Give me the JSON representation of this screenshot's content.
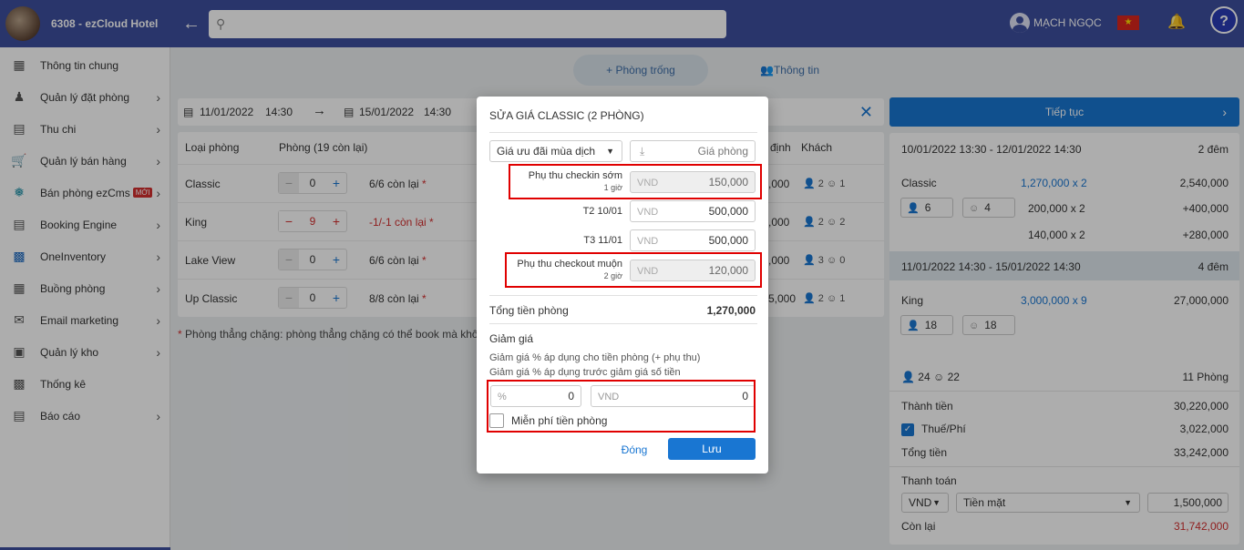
{
  "header": {
    "hotel_name": "6308 - ezCloud Hotel",
    "user_name": "MẠCH NGỌC",
    "help_label": "?"
  },
  "sidebar": {
    "items": [
      {
        "label": "Thông tin chung",
        "icon": "dashboard-icon"
      },
      {
        "label": "Quản lý đặt phòng",
        "icon": "person-bed-icon"
      },
      {
        "label": "Thu chi",
        "icon": "card-icon"
      },
      {
        "label": "Quản lý bán hàng",
        "icon": "cart-icon"
      },
      {
        "label": "Bán phòng ezCms",
        "icon": "cms-icon",
        "badge": "MỚI"
      },
      {
        "label": "Booking Engine",
        "icon": "booking-icon"
      },
      {
        "label": "OneInventory",
        "icon": "inventory-icon"
      },
      {
        "label": "Buồng phòng",
        "icon": "building-icon"
      },
      {
        "label": "Email marketing",
        "icon": "mail-icon"
      },
      {
        "label": "Quản lý kho",
        "icon": "warehouse-icon"
      },
      {
        "label": "Thống kê",
        "icon": "stats-icon"
      },
      {
        "label": "Báo cáo",
        "icon": "report-icon"
      }
    ]
  },
  "tabs": {
    "room_empty": "Phòng trống",
    "info": "Thông tin"
  },
  "datebar": {
    "from_date": "11/01/2022",
    "from_time": "14:30",
    "to_date": "15/01/2022",
    "to_time": "14:30"
  },
  "room_table": {
    "col_type": "Loại phòng",
    "col_rooms": "Phòng (19 còn lại)",
    "col_rate_partial": "định",
    "col_guests": "Khách",
    "rows": [
      {
        "name": "Classic",
        "qty": "0",
        "avail": "6/6 còn lại",
        "rate": ",000",
        "adults": "2",
        "children": "1"
      },
      {
        "name": "King",
        "qty": "9",
        "avail": "-1/-1 còn lại",
        "rate": ",000",
        "adults": "2",
        "children": "2"
      },
      {
        "name": "Lake View",
        "qty": "0",
        "avail": "6/6 còn lại",
        "rate": ",000",
        "adults": "3",
        "children": "0"
      },
      {
        "name": "Up Classic",
        "qty": "0",
        "avail": "8/8 còn lại",
        "rate": "5,000",
        "adults": "2",
        "children": "1"
      }
    ],
    "footnote": "Phòng thẳng chặng: phòng thẳng chặng có thể book mà không p"
  },
  "summary": {
    "continue_label": "Tiếp tục",
    "stay1": {
      "range": "10/01/2022 13:30 - 12/01/2022 14:30",
      "nights": "2 đêm",
      "room": "Classic",
      "rate": "1,270,000 x 2",
      "amount": "2,540,000",
      "adults": "6",
      "children": "4",
      "extra1_rate": "200,000 x 2",
      "extra1_amount": "+400,000",
      "extra2_rate": "140,000 x 2",
      "extra2_amount": "+280,000"
    },
    "stay2": {
      "range": "11/01/2022 14:30 - 15/01/2022 14:30",
      "nights": "4 đêm",
      "room": "King",
      "rate": "3,000,000 x 9",
      "amount": "27,000,000",
      "adults": "18",
      "children": "18"
    },
    "total_adults": "24",
    "total_children": "22",
    "total_rooms": "11 Phòng",
    "subtotal_label": "Thành tiền",
    "subtotal": "30,220,000",
    "tax_label": "Thuế/Phí",
    "tax": "3,022,000",
    "total_label": "Tổng tiền",
    "total": "33,242,000",
    "payment_label": "Thanh toán",
    "currency": "VND",
    "method": "Tiền mặt",
    "paid": "1,500,000",
    "remaining_label": "Còn lại",
    "remaining": "31,742,000"
  },
  "modal": {
    "title": "SỬA GIÁ CLASSIC (2 PHÒNG)",
    "season_select": "Giá ưu đãi mùa dịch",
    "price_placeholder": "Giá phòng",
    "early_label": "Phụ thu checkin sớm",
    "early_sub": "1 giờ",
    "early_currency": "VND",
    "early_amount": "150,000",
    "day1_label": "T2 10/01",
    "day1_currency": "VND",
    "day1_amount": "500,000",
    "day2_label": "T3 11/01",
    "day2_currency": "VND",
    "day2_amount": "500,000",
    "late_label": "Phụ thu checkout muộn",
    "late_sub": "2 giờ",
    "late_currency": "VND",
    "late_amount": "120,000",
    "room_total_label": "Tổng tiền phòng",
    "room_total": "1,270,000",
    "discount_label": "Giảm giá",
    "discount_note1": "Giảm giá % áp dụng cho tiền phòng (+ phụ thu)",
    "discount_note2": "Giảm giá % áp dụng trước giảm giá số tiền",
    "percent_symbol": "%",
    "percent_value": "0",
    "vnd_symbol": "VND",
    "vnd_value": "0",
    "free_room_label": "Miễn phí tiền phòng",
    "cancel_label": "Đóng",
    "save_label": "Lưu"
  },
  "colors": {
    "header": "#3d4e9e",
    "primary": "#1976d2",
    "danger": "#d32f2f",
    "highlight_box": "#e00000"
  }
}
